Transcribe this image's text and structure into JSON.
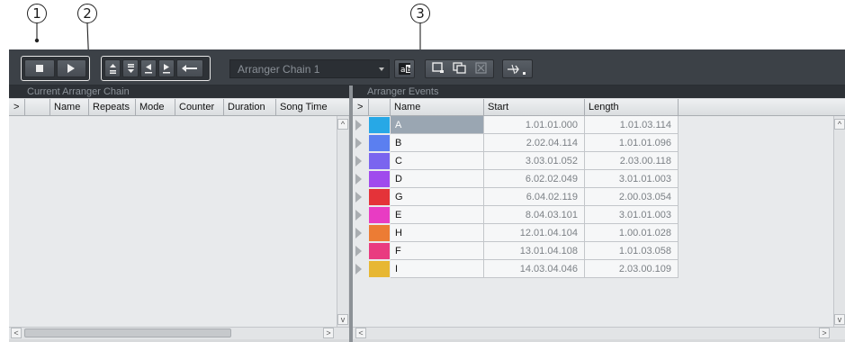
{
  "callouts": [
    "1",
    "2",
    "3"
  ],
  "toolbar": {
    "chain_name": "Arranger Chain 1",
    "transport": [
      {
        "name": "stop-icon",
        "glyph": "■"
      },
      {
        "name": "play-icon",
        "glyph": "▶"
      }
    ],
    "nav": [
      {
        "name": "first-event-icon",
        "glyph": "≜"
      },
      {
        "name": "last-event-icon",
        "glyph": "⩡"
      },
      {
        "name": "previous-chain-step-icon",
        "glyph": "⊴"
      },
      {
        "name": "next-chain-step-icon",
        "glyph": "⊵"
      },
      {
        "name": "return-icon",
        "glyph": "↤"
      }
    ],
    "rename_icon": "ab-rename-icon",
    "chain_ops_icons": [
      "create-chain-icon",
      "duplicate-chain-icon",
      "remove-chain-icon"
    ],
    "flatten_icon": "flatten-chain-icon"
  },
  "left_panel": {
    "title": "Current Arranger Chain",
    "columns": [
      ">",
      "Name",
      "Repeats",
      "Mode",
      "Counter",
      "Duration",
      "Song Time"
    ]
  },
  "right_panel": {
    "title": "Arranger Events",
    "columns": [
      ">",
      "Name",
      "Start",
      "Length"
    ],
    "colors": {
      "selected_row": "#9aa6b2"
    },
    "rows": [
      {
        "name": "A",
        "start": "1.01.01.000",
        "length": "1.01.03.114",
        "color": "#27a8e6",
        "selected": true
      },
      {
        "name": "B",
        "start": "2.02.04.114",
        "length": "1.01.01.096",
        "color": "#5b7ff0"
      },
      {
        "name": "C",
        "start": "3.03.01.052",
        "length": "2.03.00.118",
        "color": "#7a65ef"
      },
      {
        "name": "D",
        "start": "6.02.02.049",
        "length": "3.01.01.003",
        "color": "#a04bed"
      },
      {
        "name": "G",
        "start": "6.04.02.119",
        "length": "2.00.03.054",
        "color": "#e43339"
      },
      {
        "name": "E",
        "start": "8.04.03.101",
        "length": "3.01.01.003",
        "color": "#e83cc3"
      },
      {
        "name": "H",
        "start": "12.01.04.104",
        "length": "1.00.01.028",
        "color": "#ec7c34"
      },
      {
        "name": "F",
        "start": "13.01.04.108",
        "length": "1.01.03.058",
        "color": "#e93b80"
      },
      {
        "name": "I",
        "start": "14.03.04.046",
        "length": "2.03.00.109",
        "color": "#e7b733"
      }
    ]
  }
}
